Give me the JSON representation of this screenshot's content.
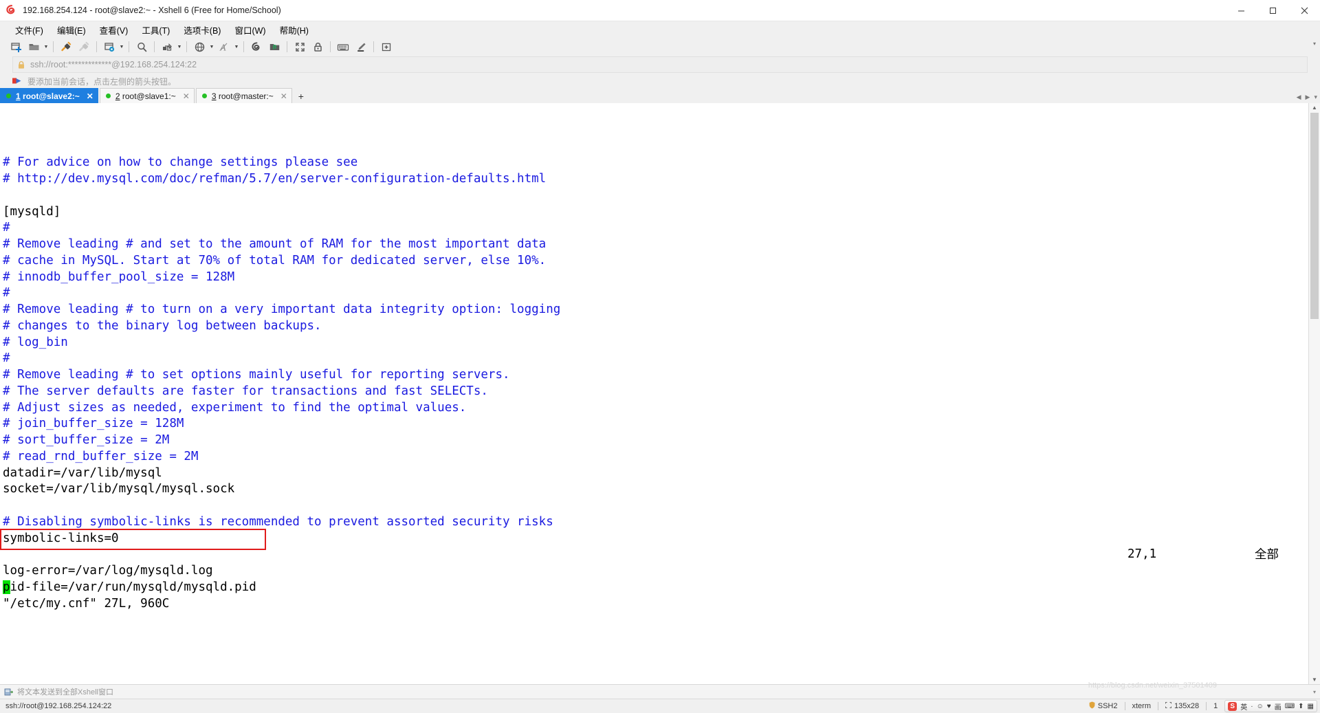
{
  "window": {
    "title": "192.168.254.124 - root@slave2:~ - Xshell 6 (Free for Home/School)",
    "app_icon": "xshell-spiral-icon",
    "minimize": "–",
    "maximize": "▢",
    "close": "✕"
  },
  "menubar": {
    "items": [
      {
        "label": "文件(F)",
        "name": "menu-file"
      },
      {
        "label": "编辑(E)",
        "name": "menu-edit"
      },
      {
        "label": "查看(V)",
        "name": "menu-view"
      },
      {
        "label": "工具(T)",
        "name": "menu-tools"
      },
      {
        "label": "选项卡(B)",
        "name": "menu-tabs"
      },
      {
        "label": "窗口(W)",
        "name": "menu-window"
      },
      {
        "label": "帮助(H)",
        "name": "menu-help"
      }
    ]
  },
  "toolbar": {
    "buttons": [
      {
        "icon": "new-session-icon",
        "caret": false
      },
      {
        "icon": "open-folder-icon",
        "caret": true
      },
      {
        "icon": "connect-plug-icon",
        "caret": false
      },
      {
        "icon": "disconnect-plug-icon",
        "caret": false
      },
      {
        "icon": "session-properties-icon",
        "caret": true
      },
      {
        "icon": "find-icon",
        "caret": false
      },
      {
        "icon": "file-transfer-icon",
        "caret": true
      },
      {
        "icon": "globe-icon",
        "caret": true
      },
      {
        "icon": "font-size-icon",
        "caret": true
      },
      {
        "icon": "xshell-spiral-icon",
        "caret": false
      },
      {
        "icon": "xftp-folder-icon",
        "caret": false
      },
      {
        "icon": "fullscreen-icon",
        "caret": false
      },
      {
        "icon": "lock-icon",
        "caret": false
      },
      {
        "icon": "keyboard-icon",
        "caret": false
      },
      {
        "icon": "highlighter-icon",
        "caret": false
      },
      {
        "icon": "add-note-icon",
        "caret": false
      }
    ],
    "overflow_caret": "▾"
  },
  "address_bar": {
    "icon": "lock-icon",
    "value": "ssh://root:*************@192.168.254.124:22",
    "placeholder": "ssh://"
  },
  "hint_bar": {
    "icon": "arrow-flag-icon",
    "text": "要添加当前会话，点击左侧的箭头按钮。"
  },
  "tabs": {
    "items": [
      {
        "index": "1",
        "label": "root@slave2:~",
        "active": true,
        "close": "✕",
        "status": "connected"
      },
      {
        "index": "2",
        "label": "root@slave1:~",
        "active": false,
        "close": "✕",
        "status": "connected"
      },
      {
        "index": "3",
        "label": "root@master:~",
        "active": false,
        "close": "✕",
        "status": "connected"
      }
    ],
    "add_label": "+",
    "nav_prev": "◀",
    "nav_next": "▶",
    "nav_list": "▾"
  },
  "terminal": {
    "lines": [
      {
        "text": "# For advice on how to change settings please see",
        "style": "comment"
      },
      {
        "text": "# http://dev.mysql.com/doc/refman/5.7/en/server-configuration-defaults.html",
        "style": "comment"
      },
      {
        "text": "",
        "style": "plain"
      },
      {
        "text": "[mysqld]",
        "style": "plain"
      },
      {
        "text": "#",
        "style": "comment"
      },
      {
        "text": "# Remove leading # and set to the amount of RAM for the most important data",
        "style": "comment"
      },
      {
        "text": "# cache in MySQL. Start at 70% of total RAM for dedicated server, else 10%.",
        "style": "comment"
      },
      {
        "text": "# innodb_buffer_pool_size = 128M",
        "style": "comment"
      },
      {
        "text": "#",
        "style": "comment"
      },
      {
        "text": "# Remove leading # to turn on a very important data integrity option: logging",
        "style": "comment"
      },
      {
        "text": "# changes to the binary log between backups.",
        "style": "comment"
      },
      {
        "text": "# log_bin",
        "style": "comment"
      },
      {
        "text": "#",
        "style": "comment"
      },
      {
        "text": "# Remove leading # to set options mainly useful for reporting servers.",
        "style": "comment"
      },
      {
        "text": "# The server defaults are faster for transactions and fast SELECTs.",
        "style": "comment"
      },
      {
        "text": "# Adjust sizes as needed, experiment to find the optimal values.",
        "style": "comment"
      },
      {
        "text": "# join_buffer_size = 128M",
        "style": "comment"
      },
      {
        "text": "# sort_buffer_size = 2M",
        "style": "comment"
      },
      {
        "text": "# read_rnd_buffer_size = 2M",
        "style": "comment"
      },
      {
        "text": "datadir=/var/lib/mysql",
        "style": "plain"
      },
      {
        "text": "socket=/var/lib/mysql/mysql.sock",
        "style": "plain"
      },
      {
        "text": "",
        "style": "plain"
      },
      {
        "text": "# Disabling symbolic-links is recommended to prevent assorted security risks",
        "style": "comment"
      },
      {
        "text": "symbolic-links=0",
        "style": "plain"
      },
      {
        "text": "",
        "style": "plain"
      },
      {
        "text": "log-error=/var/log/mysqld.log",
        "style": "plain"
      },
      {
        "text": "pid-file=/var/run/mysqld/mysqld.pid",
        "style": "plain",
        "cursor": 1,
        "highlighted": true
      }
    ],
    "status_line": "\"/etc/my.cnf\" 27L, 960C",
    "cursor_position": "27,1",
    "scroll_indicator": "全部",
    "highlight_color": "#e01b1b",
    "cursor_color": "#00e000",
    "comment_color": "#1a1ae0",
    "text_color": "#000000"
  },
  "send_bar": {
    "icon": "send-to-all-icon",
    "text": "将文本发送到全部Xshell窗口",
    "caret": "▾"
  },
  "status_bar": {
    "connection": "ssh://root@192.168.254.124:22",
    "protocol": "SSH2",
    "terminal_type": "xterm",
    "dimensions": "135x28",
    "num_lock": "1",
    "tray": {
      "logo": "S",
      "items": [
        "英",
        "·",
        "☺",
        "♥",
        "画",
        "⌨",
        "⬆",
        "▦"
      ]
    }
  },
  "watermark": "https://blog.csdn.net/weixin_37501409"
}
